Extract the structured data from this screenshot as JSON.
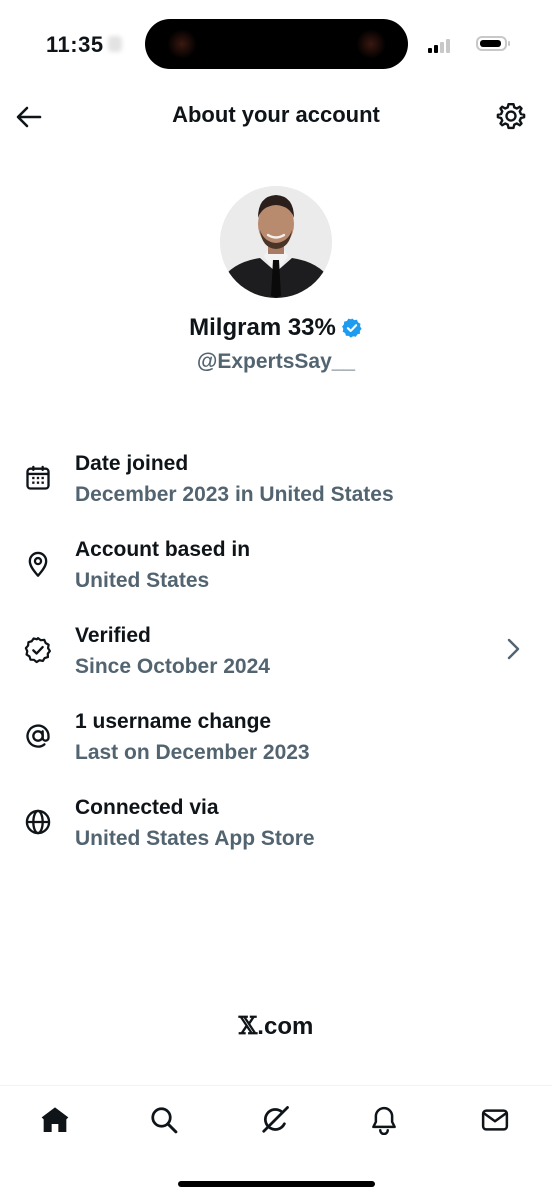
{
  "status_bar": {
    "time": "11:35"
  },
  "header": {
    "title": "About your account",
    "back_icon": "arrow-left-icon",
    "settings_icon": "gear-icon"
  },
  "profile": {
    "display_name": "Milgram 33%",
    "handle": "@ExpertsSay__",
    "verified_badge_color": "#1d9bf0"
  },
  "info_items": [
    {
      "icon": "calendar-icon",
      "title": "Date joined",
      "subtitle": "December 2023 in United States"
    },
    {
      "icon": "location-pin-icon",
      "title": "Account based in",
      "subtitle": "United States"
    },
    {
      "icon": "verified-badge-icon",
      "title": "Verified",
      "subtitle": "Since October 2024",
      "has_chevron": true
    },
    {
      "icon": "at-sign-icon",
      "title": "1 username change",
      "subtitle": "Last on December 2023"
    },
    {
      "icon": "globe-icon",
      "title": "Connected via",
      "subtitle": "United States App Store"
    }
  ],
  "footer": {
    "brand_mark": "𝕏",
    "brand_suffix": ".com"
  },
  "tab_bar": {
    "tabs": [
      {
        "icon": "home-icon",
        "active": true
      },
      {
        "icon": "search-icon",
        "active": false
      },
      {
        "icon": "grok-icon",
        "active": false
      },
      {
        "icon": "bell-icon",
        "active": false
      },
      {
        "icon": "mail-icon",
        "active": false
      }
    ]
  },
  "colors": {
    "primary_text": "#0f1419",
    "secondary_text": "#536471",
    "accent": "#1d9bf0"
  }
}
